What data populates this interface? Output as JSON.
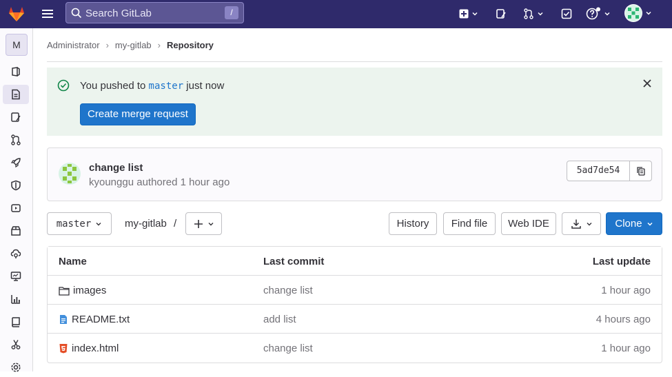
{
  "header": {
    "search_placeholder": "Search GitLab",
    "search_shortcut": "/"
  },
  "sidebar": {
    "project_initial": "M",
    "items": [
      {
        "icon": "project-overview-icon"
      },
      {
        "icon": "repository-icon",
        "active": true
      },
      {
        "icon": "issues-icon"
      },
      {
        "icon": "merge-requests-icon"
      },
      {
        "icon": "rocket-icon"
      },
      {
        "icon": "shield-icon"
      },
      {
        "icon": "deployments-icon"
      },
      {
        "icon": "package-icon"
      },
      {
        "icon": "infrastructure-icon"
      },
      {
        "icon": "monitor-icon"
      },
      {
        "icon": "analytics-icon"
      },
      {
        "icon": "wiki-icon"
      },
      {
        "icon": "snippets-icon"
      },
      {
        "icon": "settings-icon"
      }
    ]
  },
  "breadcrumb": {
    "items": [
      "Administrator",
      "my-gitlab",
      "Repository"
    ]
  },
  "alert": {
    "prefix": "You pushed to",
    "branch": "master",
    "suffix": "just now",
    "button_label": "Create merge request"
  },
  "commit": {
    "title": "change list",
    "meta": "kyounggu authored 1 hour ago",
    "sha": "5ad7de54"
  },
  "toolbar": {
    "branch": "master",
    "path": "my-gitlab",
    "path_sep": "/",
    "history_label": "History",
    "find_file_label": "Find file",
    "web_ide_label": "Web IDE",
    "clone_label": "Clone"
  },
  "table": {
    "headers": {
      "name": "Name",
      "last_commit": "Last commit",
      "last_update": "Last update"
    },
    "rows": [
      {
        "type": "folder",
        "name": "images",
        "commit": "change list",
        "updated": "1 hour ago"
      },
      {
        "type": "text-file",
        "name": "README.txt",
        "commit": "add list",
        "updated": "4 hours ago"
      },
      {
        "type": "html-file",
        "name": "index.html",
        "commit": "change list",
        "updated": "1 hour ago"
      }
    ]
  },
  "colors": {
    "topbar": "#2f2a6b",
    "primary": "#1f75cb",
    "alert_bg": "#ecf4ee",
    "success": "#108548"
  }
}
